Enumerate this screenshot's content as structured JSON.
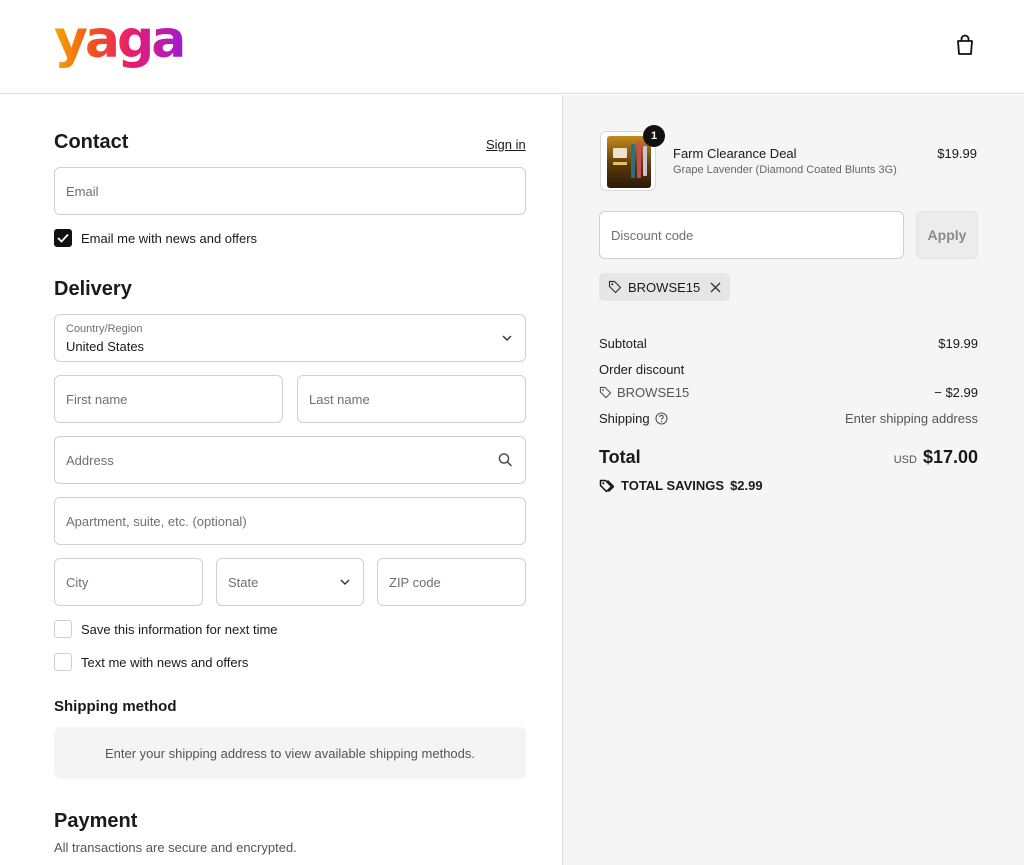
{
  "brand": {
    "logo_text": "yaga"
  },
  "header": {
    "cart_icon": "shopping-bag-icon"
  },
  "contact": {
    "title": "Contact",
    "sign_in": "Sign in",
    "email_placeholder": "Email",
    "news_label": "Email me with news and offers",
    "news_checked": true
  },
  "delivery": {
    "title": "Delivery",
    "country_label": "Country/Region",
    "country_value": "United States",
    "first_name_placeholder": "First name",
    "last_name_placeholder": "Last name",
    "address_placeholder": "Address",
    "apartment_placeholder": "Apartment, suite, etc. (optional)",
    "city_placeholder": "City",
    "state_placeholder": "State",
    "zip_placeholder": "ZIP code",
    "save_info_label": "Save this information for next time",
    "text_me_label": "Text me with news and offers"
  },
  "shipping_method": {
    "title": "Shipping method",
    "note": "Enter your shipping address to view available shipping methods."
  },
  "payment": {
    "title": "Payment",
    "subtitle": "All transactions are secure and encrypted."
  },
  "order": {
    "product": {
      "quantity": "1",
      "name": "Farm Clearance Deal",
      "variant": "Grape Lavender (Diamond Coated Blunts 3G)",
      "price": "$19.99"
    },
    "discount_placeholder": "Discount code",
    "apply_label": "Apply",
    "applied_code": "BROWSE15",
    "subtotal_label": "Subtotal",
    "subtotal_value": "$19.99",
    "order_discount_label": "Order discount",
    "discount_code": "BROWSE15",
    "discount_value": "− $2.99",
    "shipping_label": "Shipping",
    "shipping_value": "Enter shipping address",
    "total_label": "Total",
    "total_currency": "USD",
    "total_value": "$17.00",
    "savings_label": "TOTAL SAVINGS",
    "savings_value": "$2.99"
  }
}
